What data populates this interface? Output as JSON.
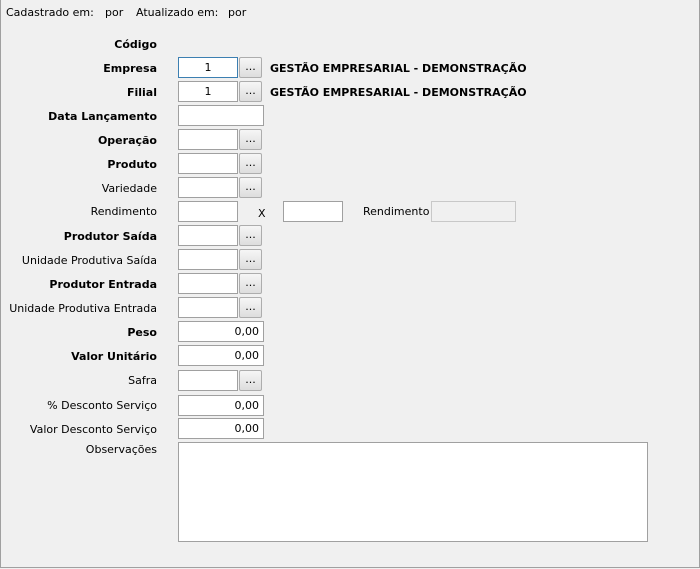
{
  "header": {
    "cadastrado_label": "Cadastrado em:",
    "cadastrado_por": "por",
    "atualizado_label": "Atualizado em:",
    "atualizado_por": "por"
  },
  "labels": {
    "codigo": "Código",
    "empresa": "Empresa",
    "filial": "Filial",
    "data_lancamento": "Data Lançamento",
    "operacao": "Operação",
    "produto": "Produto",
    "variedade": "Variedade",
    "rendimento": "Rendimento",
    "rendimento_x": "X",
    "rendimento_right": "Rendimento",
    "produtor_saida": "Produtor Saída",
    "unidade_saida": "Unidade Produtiva Saída",
    "produtor_entrada": "Produtor Entrada",
    "unidade_entrada": "Unidade Produtiva Entrada",
    "peso": "Peso",
    "valor_unitario": "Valor Unitário",
    "safra": "Safra",
    "perc_desconto": "% Desconto Serviço",
    "valor_desconto": "Valor Desconto Serviço",
    "observacoes": "Observações"
  },
  "values": {
    "empresa": "1",
    "empresa_nome": "GESTÃO EMPRESARIAL - DEMONSTRAÇÃO",
    "filial": "1",
    "filial_nome": "GESTÃO EMPRESARIAL - DEMONSTRAÇÃO",
    "peso": "0,00",
    "valor_unitario": "0,00",
    "perc_desconto": "0,00",
    "valor_desconto": "0,00"
  },
  "lookup_button_label": "..."
}
